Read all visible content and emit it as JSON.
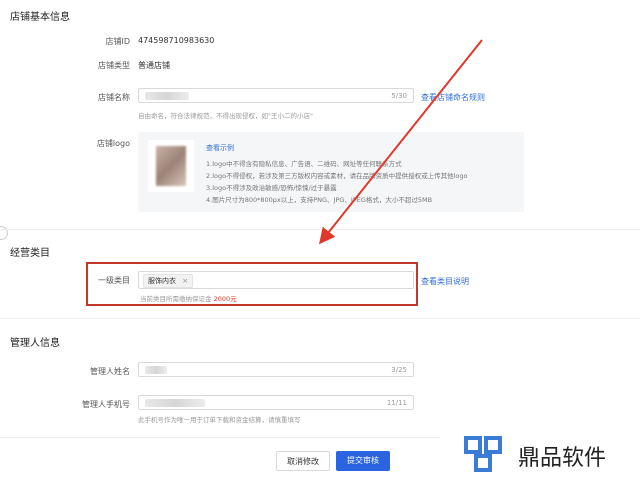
{
  "store_basic": {
    "title": "店铺基本信息",
    "id_label": "店铺ID",
    "id_value": "474598710983630",
    "type_label": "店铺类型",
    "type_value": "普通店铺",
    "name_label": "店铺名称",
    "name_counter": "5/30",
    "name_rule_link": "查看店铺命名规则",
    "name_hint": "自由命名，符合法律规范，不得出现侵权，如\"王小二的小店\"",
    "logo_label": "店铺logo",
    "logo_example_link": "查看示例",
    "logo_rules": [
      "1.logo中不得含有隐私信息、广告语、二维码、网址等任何联系方式",
      "2.logo不得侵权，若涉及第三方版权内容或素材，请在品牌资质中提供授权或上传其他logo",
      "3.logo不得涉及政治敏感/恐怖/惊悚/过于暴露",
      "4.图片尺寸为800*800px以上，支持PNG、JPG、JPEG格式，大小不超过5MB"
    ]
  },
  "category": {
    "title": "经营类目",
    "level1_label": "一级类目",
    "tag": "服饰内衣",
    "tag_close": "×",
    "desc_link": "查看类目说明",
    "deposit_prefix": "当前类目所需缴纳保证金",
    "deposit_amount": "2000元"
  },
  "manager": {
    "title": "管理人信息",
    "name_label": "管理人姓名",
    "name_counter": "3/25",
    "phone_label": "管理人手机号",
    "phone_counter": "11/11",
    "phone_hint": "此手机号作为唯一用于订单下载和资金结算，请慎重填写"
  },
  "actions": {
    "cancel": "取消修改",
    "submit": "提交审核"
  },
  "watermark": {
    "text": "鼎品软件"
  },
  "colors": {
    "link": "#2f6fd8",
    "primary": "#2a64e0",
    "highlight_box": "#c0392b",
    "arrow": "#e0392b",
    "deposit": "#e0392b"
  }
}
